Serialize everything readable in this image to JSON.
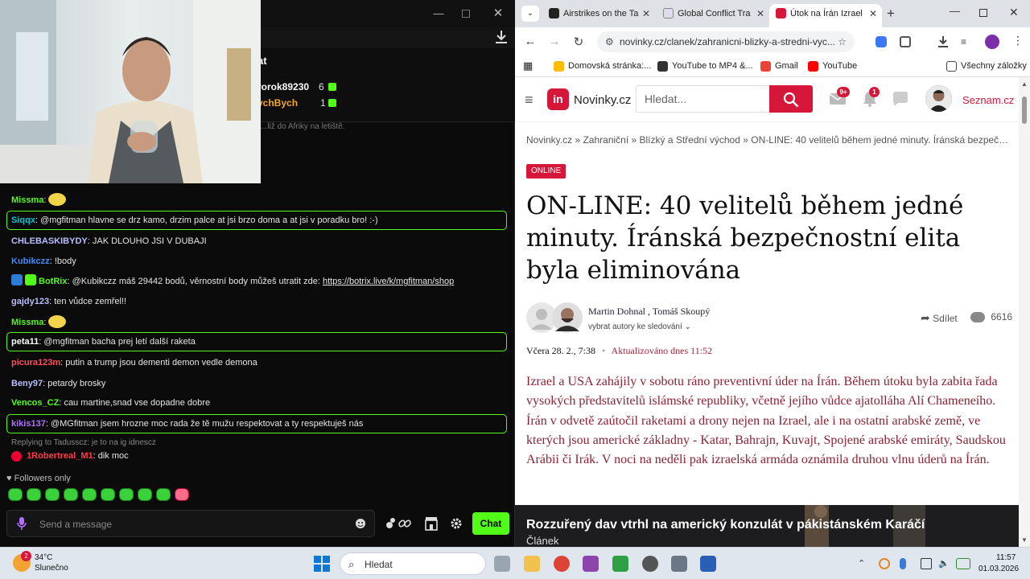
{
  "chat": {
    "header_title": "at",
    "leaderboard": [
      {
        "name": "rorok89230",
        "count": "6",
        "color": "#ffffff"
      },
      {
        "name": "ychBych",
        "count": "1",
        "color": "#f6a623"
      }
    ],
    "pinned_snippet": "...liž do Afriky na letiště.",
    "messages": [
      {
        "user": "Missma",
        "color": "#53fc18",
        "text": "",
        "emote": true,
        "highlight": false
      },
      {
        "user": "Siqqx",
        "color": "#00c8d4",
        "text": "@mgfitman hlavne se drz kamo, drzim palce at jsi brzo doma a at jsi v poradku bro! :-)",
        "emote": false,
        "highlight": true
      },
      {
        "user": "CHLEBASKIBYDY",
        "color": "#b7bfff",
        "text": "JAK DLOUHO JSI V DUBAJI",
        "emote": false,
        "highlight": false
      },
      {
        "user": "Kubikczz",
        "color": "#3d8bff",
        "text": "!body",
        "emote": false,
        "highlight": false
      },
      {
        "user": "BotRix",
        "color": "#53fc18",
        "text": "@Kubikczz máš 29442 bodů, věrnostní body můžeš utratit zde: ",
        "link": "https://botrix.live/k/mgfitman/shop",
        "emote": false,
        "highlight": false,
        "badges": true
      },
      {
        "user": "gajdy123",
        "color": "#b7bfff",
        "text": "ten vůdce zemřel!!",
        "emote": false,
        "highlight": false
      },
      {
        "user": "Missma",
        "color": "#53fc18",
        "text": "",
        "emote": true,
        "highlight": false
      },
      {
        "user": "peta11",
        "color": "#ffffff",
        "text": "@mgfitman bacha prej letí další raketa",
        "emote": false,
        "highlight": true
      },
      {
        "user": "picura123m",
        "color": "#ff4d5e",
        "text": "putin a trump jsou dementi demon vedle demona",
        "emote": false,
        "highlight": false
      },
      {
        "user": "Beny97",
        "color": "#b7bfff",
        "text": "petardy brosky",
        "emote": false,
        "highlight": false
      },
      {
        "user": "Vencos_CZ",
        "color": "#53fc18",
        "text": "cau martine,snad vse dopadne dobre",
        "emote": false,
        "highlight": false
      },
      {
        "user": "kikis137",
        "color": "#b070ff",
        "text": "@MGfitman jsem hrozne moc rada že tě mužu respektovat a ty respektuješ nás",
        "emote": false,
        "highlight": true
      }
    ],
    "reply_line": "Replying to Tadusscz: je to na ig idnescz",
    "reply_user": "1Robertreal_M1",
    "reply_text": "dik moc",
    "followers_only": "Followers only",
    "input_placeholder": "Send a message",
    "send_label": "Chat",
    "accent": "#53fc18"
  },
  "browser": {
    "tabs": [
      {
        "title": "Airstrikes on the Ta",
        "active": false
      },
      {
        "title": "Global Conflict Tra",
        "active": false
      },
      {
        "title": "Útok na Írán Izrael",
        "active": true
      }
    ],
    "url": "novinky.cz/clanek/zahranicni-blizky-a-stredni-vyc...",
    "bookmarks": [
      "Domovská stránka:...",
      "YouTube to MP4 &...",
      "Gmail",
      "YouTube"
    ],
    "all_bookmarks": "Všechny záložky"
  },
  "site": {
    "logo_mark": "in",
    "logo_text": "Novinky.cz",
    "search_placeholder": "Hledat...",
    "mail_badge": "9+",
    "bell_badge": "1",
    "seznam": "Seznam.cz",
    "brand_color": "#d6173a"
  },
  "article": {
    "breadcrumb": "Novinky.cz » Zahraniční » Blízký a Střední východ » ON-LINE: 40 velitelů během jedné minuty. Íránská bezpečnostní elita byla eliminována",
    "badge": "ONLINE",
    "headline": "ON-LINE: 40 velitelů během jedné minuty. Íránská bezpečnostní elita byla eliminována",
    "authors": "Martin Dohnal , Tomáš Skoupý",
    "follow_authors": "vybrat autory ke sledování ⌄",
    "share": "Sdílet",
    "comments": "6616",
    "date": "Včera 28. 2., 7:38",
    "updated": "Aktualizováno dnes 11:52",
    "perex": "Izrael a USA zahájily v sobotu ráno preventivní úder na Írán. Během útoku byla zabita řada vysokých představitelů islámské republiky, včetně jejího vůdce ajatolláha Alí Chameneího. Írán v odvetě zaútočil raketami a drony nejen na Izrael, ale i na ostatní arabské země, ve kterých jsou americké základny - Katar, Bahrajn, Kuvajt, Spojené arabské emiráty, Saudskou Arábii či Irák. V noci na neděli pak izraelská armáda oznámila druhou vlnu úderů na Írán.",
    "video_title": "Rozzuřený dav vtrhl na americký konzulát v pákistánském Karáčí",
    "video_label": "Článek"
  },
  "taskbar": {
    "weather_badge": "2",
    "temp": "34°C",
    "condition": "Slunečno",
    "search": "Hledat",
    "time": "11:57",
    "date": "01.03.2026"
  }
}
